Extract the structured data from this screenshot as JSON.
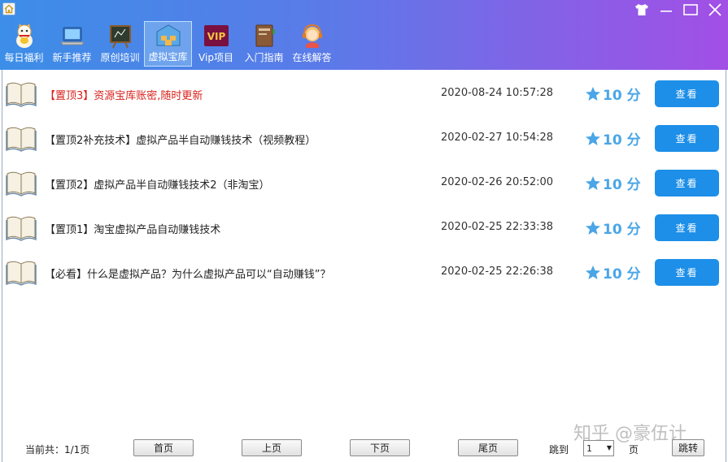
{
  "window": {
    "controls": [
      "skin-icon",
      "minimize-icon",
      "maximize-icon",
      "close-icon"
    ]
  },
  "toolbar": {
    "items": [
      {
        "label": "每日福利",
        "icon": "lucky-cat-icon"
      },
      {
        "label": "新手推荐",
        "icon": "laptop-icon"
      },
      {
        "label": "原创培训",
        "icon": "blackboard-icon"
      },
      {
        "label": "虚拟宝库",
        "icon": "warehouse-icon",
        "active": true
      },
      {
        "label": "Vip项目",
        "icon": "vip-icon",
        "badge": "VIP"
      },
      {
        "label": "入门指南",
        "icon": "guide-book-icon"
      },
      {
        "label": "在线解答",
        "icon": "support-agent-icon"
      }
    ]
  },
  "list": {
    "view_label": "查看",
    "items": [
      {
        "title": "【置顶3】资源宝库账密,随时更新",
        "highlight": true,
        "date": "2020-08-24  10:57:28",
        "score": "10 分"
      },
      {
        "title": "【置顶2补充技术】虚拟产品半自动赚钱技术（视频教程）",
        "highlight": false,
        "date": "2020-02-27  10:54:28",
        "score": "10 分"
      },
      {
        "title": "【置顶2】虚拟产品半自动赚钱技术2（非淘宝）",
        "highlight": false,
        "date": "2020-02-26  20:52:00",
        "score": "10 分"
      },
      {
        "title": "【置顶1】淘宝虚拟产品自动赚钱技术",
        "highlight": false,
        "date": "2020-02-25  22:33:38",
        "score": "10 分"
      },
      {
        "title": "【必看】什么是虚拟产品？为什么虚拟产品可以“自动赚钱”？",
        "highlight": false,
        "date": "2020-02-25  22:26:38",
        "score": "10 分"
      }
    ]
  },
  "footer": {
    "page_info": "当前共：1/1页",
    "first": "首页",
    "prev": "上页",
    "next": "下页",
    "last": "尾页",
    "jump_label": "跳到",
    "jump_value": "1",
    "page_unit": "页",
    "go": "跳转"
  },
  "watermark": "知乎 @豪伍计",
  "colors": {
    "highlight_text": "#d8221c",
    "view_button": "#1d8fe8",
    "score": "#4aa6e6",
    "header_gradient_start": "#3c8ee8",
    "header_gradient_end": "#a24fe6"
  }
}
